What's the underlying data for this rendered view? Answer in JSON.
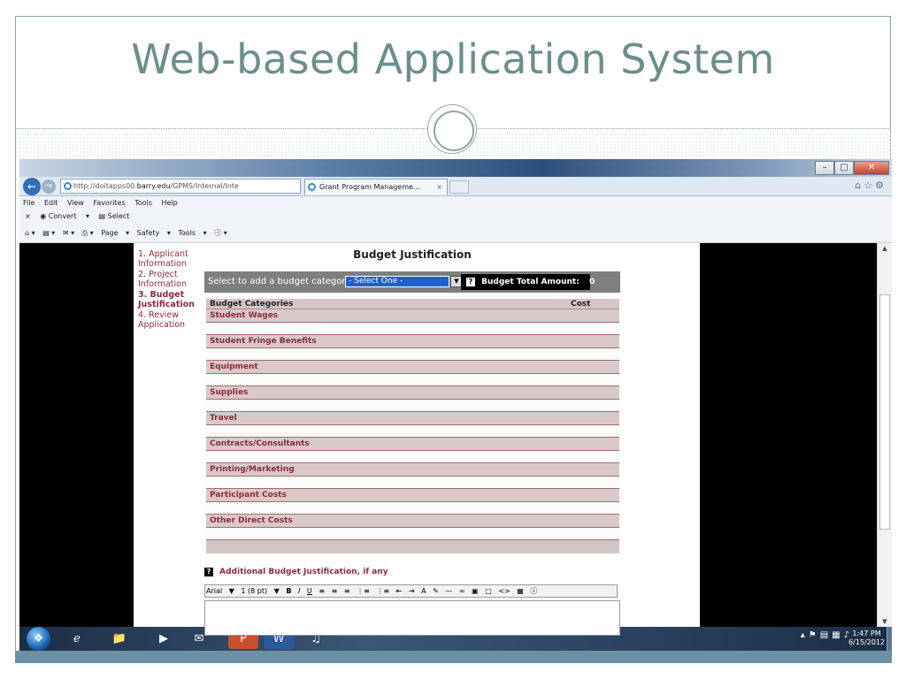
{
  "slide": {
    "title": "Web-based Application System"
  },
  "browser": {
    "address": "http://doitapps00.barry.edu/GPMS/Internal/Inte",
    "address_domain": "barry.edu",
    "tab_title": "Grant Program Manageme...",
    "menus": [
      "File",
      "Edit",
      "View",
      "Favorites",
      "Tools",
      "Help"
    ],
    "fav_items": [
      "Convert",
      "Select"
    ],
    "cmd_items": [
      "Page",
      "Safety",
      "Tools"
    ]
  },
  "page": {
    "heading": "Budget Justification",
    "steps": [
      {
        "label": "1. Applicant Information",
        "active": false
      },
      {
        "label": "2. Project Information",
        "active": false
      },
      {
        "label": "3. Budget Justification",
        "active": true
      },
      {
        "label": "4. Review Application",
        "active": false
      }
    ],
    "select_label": "Select to add a budget category",
    "select_value": "- Select One -",
    "total_label": "Budget Total Amount:",
    "total_value": "0",
    "table": {
      "header_category": "Budget Categories",
      "header_cost": "Cost",
      "categories": [
        "Student Wages",
        "Student Fringe Benefits",
        "Equipment",
        "Supplies",
        "Travel",
        "Contracts/Consultants",
        "Printing/Marketing",
        "Participant Costs",
        "Other Direct Costs"
      ]
    },
    "additional_label": "Additional Budget Justification, if any",
    "editor_font": "Arial",
    "editor_size": "1 (8 pt)"
  },
  "taskbar": {
    "time": "1:47 PM",
    "date": "6/15/2012"
  },
  "colors": {
    "title": "#6b8e8c",
    "step_text": "#8b2b3e",
    "category_bg": "#d9c9c9",
    "select_bar": "#7f7f7f"
  },
  "icons": [
    "back-icon",
    "forward-icon",
    "ie-icon",
    "home-icon",
    "star-icon",
    "gear-icon",
    "start-icon"
  ]
}
